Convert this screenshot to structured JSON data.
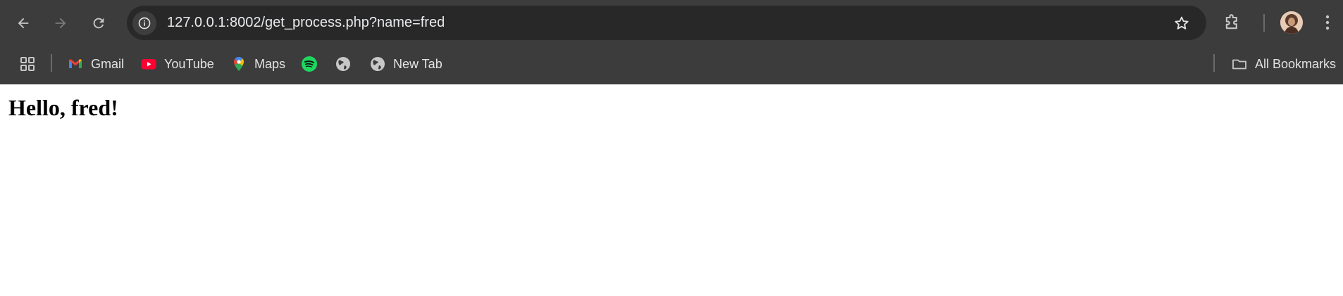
{
  "browser": {
    "url": "127.0.0.1:8002/get_process.php?name=fred",
    "nav": {
      "back_icon": "arrow-left-icon",
      "forward_icon": "arrow-right-icon",
      "reload_icon": "reload-icon"
    },
    "colors": {
      "toolbar_bg": "#3c3c3c",
      "omnibox_bg": "#282828",
      "text": "#e3e3e3"
    }
  },
  "bookmarks": {
    "items": [
      {
        "label": "Gmail",
        "icon": "gmail-icon"
      },
      {
        "label": "YouTube",
        "icon": "youtube-icon"
      },
      {
        "label": "Maps",
        "icon": "maps-icon"
      },
      {
        "label": "",
        "icon": "spotify-icon"
      },
      {
        "label": "",
        "icon": "globe-icon"
      },
      {
        "label": "New Tab",
        "icon": "globe-icon"
      }
    ],
    "all_bookmarks_label": "All Bookmarks"
  },
  "page": {
    "heading": "Hello, fred!"
  }
}
